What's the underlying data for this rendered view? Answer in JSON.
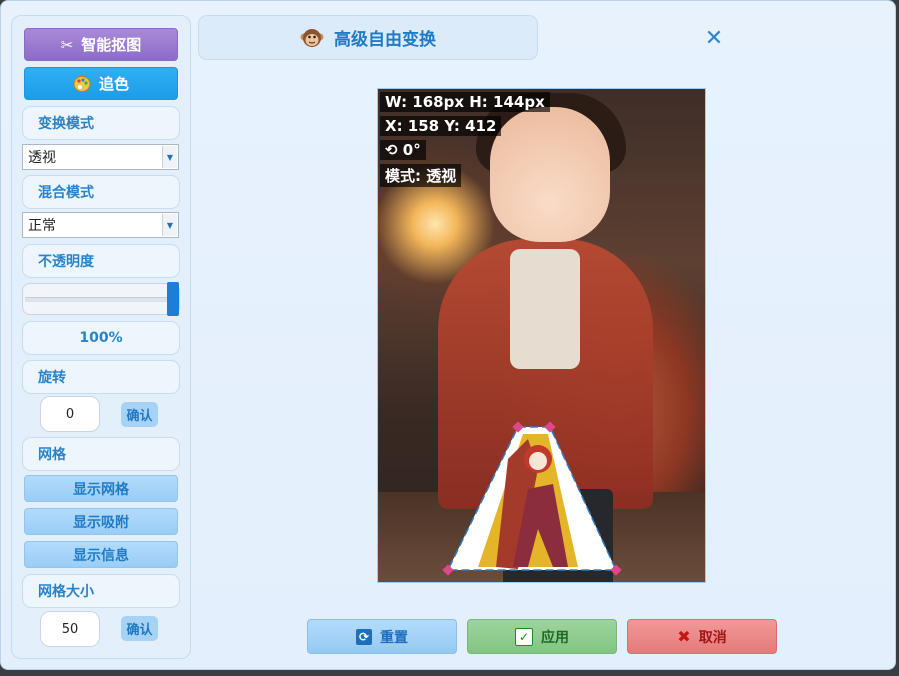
{
  "sidebar": {
    "matting_button": "智能抠图",
    "color_button": "追色",
    "transform_mode_label": "变换模式",
    "transform_mode_value": "透视",
    "blend_mode_label": "混合模式",
    "blend_mode_value": "正常",
    "opacity_label": "不透明度",
    "opacity_value_text": "100%",
    "opacity_value": 1.0,
    "rotate_label": "旋转",
    "rotate_value": "0",
    "rotate_confirm": "确认",
    "grid_label": "网格",
    "show_grid": "显示网格",
    "show_snap": "显示吸附",
    "show_info": "显示信息",
    "grid_size_label": "网格大小",
    "grid_size_value": "50",
    "grid_size_confirm": "确认"
  },
  "header": {
    "title": "高级自由变换",
    "title_icon": "monkey-face-icon",
    "close_icon": "close-icon"
  },
  "canvas": {
    "info": {
      "size": "W: 168px H: 144px",
      "position": "X: 158 Y: 412",
      "rotation": "⟲ 0°",
      "mode": "模式: 透视"
    }
  },
  "actions": {
    "reset": "重置",
    "apply": "应用",
    "cancel": "取消"
  },
  "colors": {
    "accent": "#1f7bc6",
    "matting": "#9c7dd2",
    "color_btn": "#22a5ee",
    "apply": "#8ccb8c",
    "cancel": "#ec8a8a",
    "handle": "#e0468a"
  }
}
